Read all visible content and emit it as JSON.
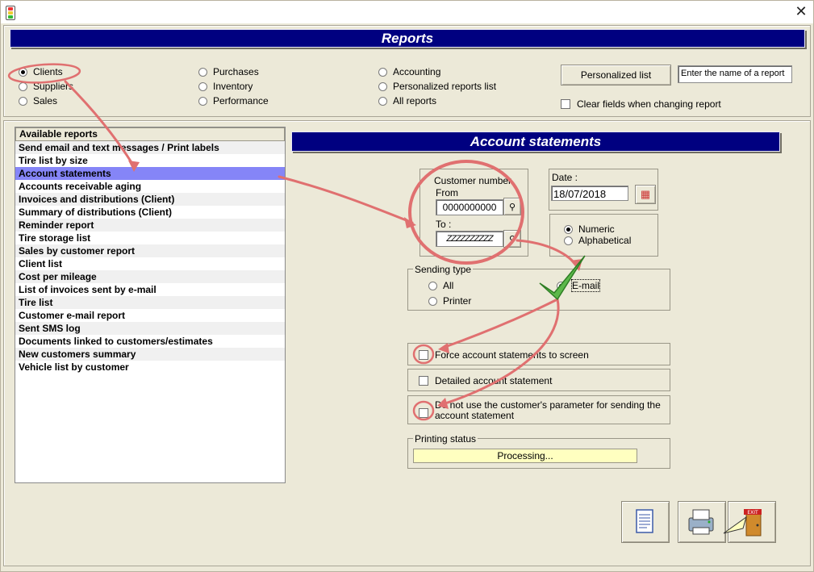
{
  "window": {
    "title": ""
  },
  "header": {
    "banner_title": "Reports"
  },
  "report_type": {
    "options": [
      {
        "label": "Clients",
        "selected": true
      },
      {
        "label": "Suppliers",
        "selected": false
      },
      {
        "label": "Sales",
        "selected": false
      },
      {
        "label": "Purchases",
        "selected": false
      },
      {
        "label": "Inventory",
        "selected": false
      },
      {
        "label": "Performance",
        "selected": false
      },
      {
        "label": "Accounting",
        "selected": false
      },
      {
        "label": "Personalized reports list",
        "selected": false
      },
      {
        "label": "All reports",
        "selected": false
      }
    ]
  },
  "personalized": {
    "button_label": "Personalized list",
    "report_name_value": "Enter the name of a report",
    "clear_fields_label": "Clear fields when changing report"
  },
  "reports_list": {
    "header": "Available reports",
    "items": [
      "Send email and text messages / Print labels",
      "Tire list by size",
      "Account statements",
      "Accounts receivable aging",
      "Invoices and distributions (Client)",
      "Summary of distributions (Client)",
      "Reminder report",
      "Tire storage list",
      "Sales by customer report",
      "Client list",
      "Cost per mileage",
      "List of invoices sent by e-mail",
      "Tire list",
      "Customer e-mail report",
      "Sent SMS log",
      "Documents linked to customers/estimates",
      "New customers summary",
      "Vehicle list by customer"
    ],
    "selected": "Account statements"
  },
  "account_statements": {
    "banner_title": "Account statements",
    "customer_number_label": "Customer number",
    "from_label": "From",
    "from_value": "0000000000",
    "to_label": "To :",
    "to_value": "ZZZZZZZZZZ",
    "date_label": "Date :",
    "date_value": "18/07/2018",
    "sort": {
      "numeric_label": "Numeric",
      "alphabetical_label": "Alphabetical",
      "selected": "Numeric"
    },
    "sending_type": {
      "title": "Sending type",
      "all_label": "All",
      "printer_label": "Printer",
      "email_label": "E-mail",
      "selected": "E-mail"
    },
    "force_screen_label": "Force account statements to screen",
    "detailed_label": "Detailed account statement",
    "do_not_use_label_1": "Do not use the customer's parameter for sending the",
    "do_not_use_label_2": "account statement",
    "printing_status_title": "Printing status",
    "printing_status_value": "Processing...",
    "exit_label": "EXIT"
  },
  "colors": {
    "banner": "#000080",
    "selected_row": "#8585f7",
    "status_bg": "#ffffc0",
    "annotation": "#e07070",
    "check_mark": "#5cb84a"
  }
}
